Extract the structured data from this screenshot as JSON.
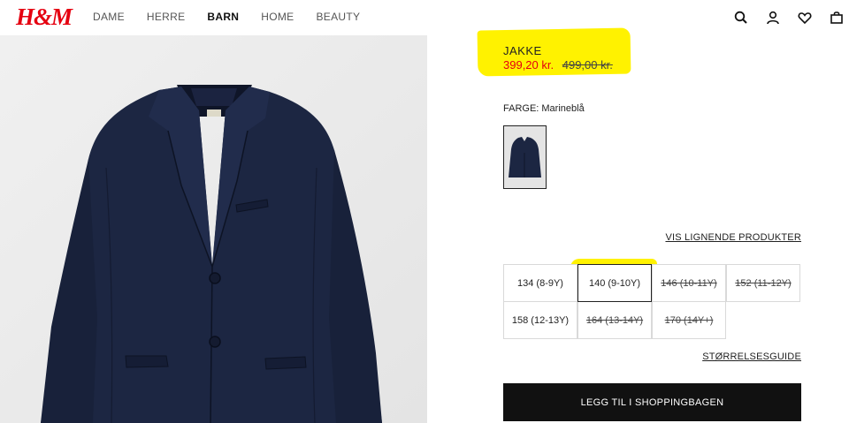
{
  "brand": {
    "logo_text": "H&M",
    "logo_color": "#e50010"
  },
  "nav": {
    "items": [
      {
        "label": "DAME",
        "active": false
      },
      {
        "label": "HERRE",
        "active": false
      },
      {
        "label": "BARN",
        "active": true
      },
      {
        "label": "HOME",
        "active": false
      },
      {
        "label": "BEAUTY",
        "active": false
      }
    ]
  },
  "header_icons": [
    "search-icon",
    "account-icon",
    "heart-icon",
    "shopping-bag-icon"
  ],
  "product": {
    "title": "JAKKE",
    "price_sale": "399,20 kr.",
    "price_original": "499,00 kr.",
    "color_label": "FARGE: Marineblå",
    "similar_link": "VIS LIGNENDE PRODUKTER",
    "size_guide_link": "STØRRELSESGUIDE",
    "add_to_bag": "LEGG TIL I SHOPPINGBAGEN"
  },
  "sizes": [
    {
      "label": "134 (8-9Y)",
      "available": true,
      "selected": false
    },
    {
      "label": "140 (9-10Y)",
      "available": true,
      "selected": true
    },
    {
      "label": "146 (10-11Y)",
      "available": false,
      "selected": false
    },
    {
      "label": "152 (11-12Y)",
      "available": false,
      "selected": false
    },
    {
      "label": "158 (12-13Y)",
      "available": true,
      "selected": false
    },
    {
      "label": "164 (13-14Y)",
      "available": false,
      "selected": false
    },
    {
      "label": "170 (14Y+)",
      "available": false,
      "selected": false
    }
  ],
  "colors": {
    "sale_price": "#e50010",
    "highlight": "#fff200",
    "button_bg": "#111111",
    "jacket": "#1a2440"
  }
}
